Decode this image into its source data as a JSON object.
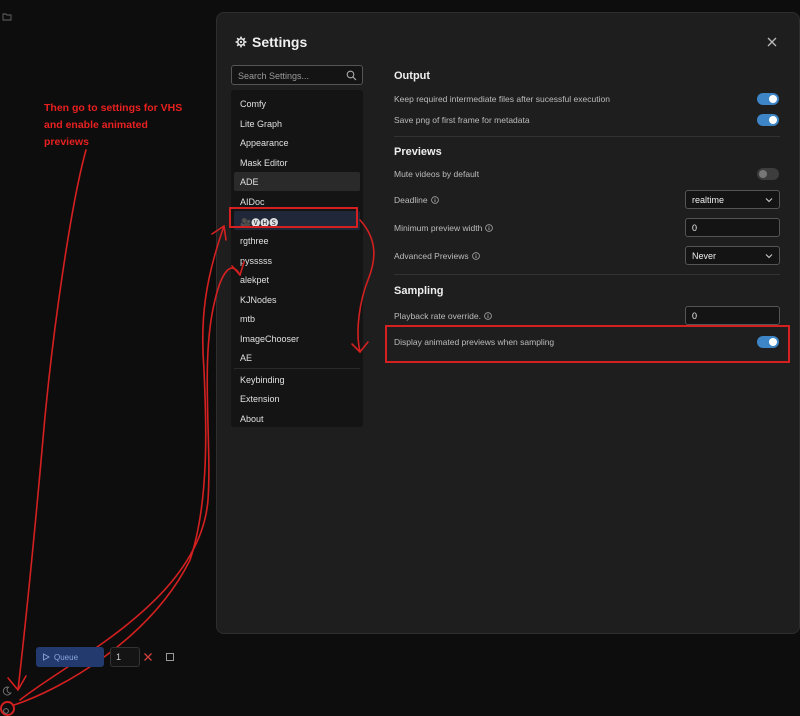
{
  "dialog": {
    "title": "Settings",
    "search_placeholder": "Search Settings..."
  },
  "categories": [
    "Comfy",
    "Lite Graph",
    "Appearance",
    "Mask Editor",
    "ADE",
    "AIDoc",
    "🎥🅥🅗🅢",
    "rgthree",
    "pysssss",
    "alekpet",
    "KJNodes",
    "mtb",
    "ImageChooser",
    "AE"
  ],
  "bottom_categories": [
    "Keybinding",
    "Extension",
    "About"
  ],
  "active_category": "ADE",
  "output": {
    "heading": "Output",
    "keep_intermediate": "Keep required intermediate files after sucessful execution",
    "save_png": "Save png of first frame for metadata"
  },
  "previews": {
    "heading": "Previews",
    "mute_videos": "Mute videos by default",
    "deadline_label": "Deadline",
    "deadline_value": "realtime",
    "min_width_label": "Minimum preview width",
    "min_width_value": "0",
    "advanced_label": "Advanced Previews",
    "advanced_value": "Never"
  },
  "sampling": {
    "heading": "Sampling",
    "playback_label": "Playback rate override.",
    "playback_value": "0",
    "display_animated": "Display animated previews when sampling"
  },
  "toggles": {
    "keep_intermediate": true,
    "save_png": true,
    "mute_videos": false,
    "display_animated": true
  },
  "annotation": "Then go to settings for VHS and enable animated previews",
  "queue": {
    "button_label": "Queue",
    "count": "1"
  },
  "stats_text": "",
  "colors": {
    "accent": "#3d85c6",
    "annotation_red": "#d42020"
  }
}
